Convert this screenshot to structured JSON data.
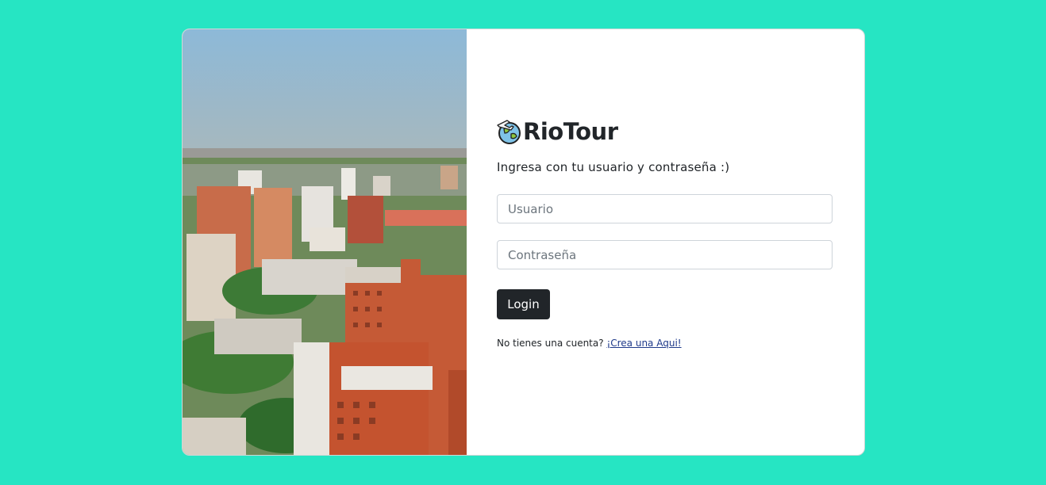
{
  "brand": {
    "name": "RioTour",
    "logo_icon": "globe-airplane-icon"
  },
  "login": {
    "subtitle": "Ingresa con tu usuario y contraseña :)",
    "username_placeholder": "Usuario",
    "password_placeholder": "Contraseña",
    "username_value": "",
    "password_value": "",
    "submit_label": "Login"
  },
  "signup": {
    "prompt": "No tienes una cuenta?",
    "link_label": "¡Crea una Aqui!"
  },
  "colors": {
    "page_background": "#26e5c3",
    "card_background": "#ffffff",
    "button_background": "#212529",
    "link": "#1f3a8a"
  },
  "hero_image": {
    "icon": "city-skyline-photo"
  }
}
